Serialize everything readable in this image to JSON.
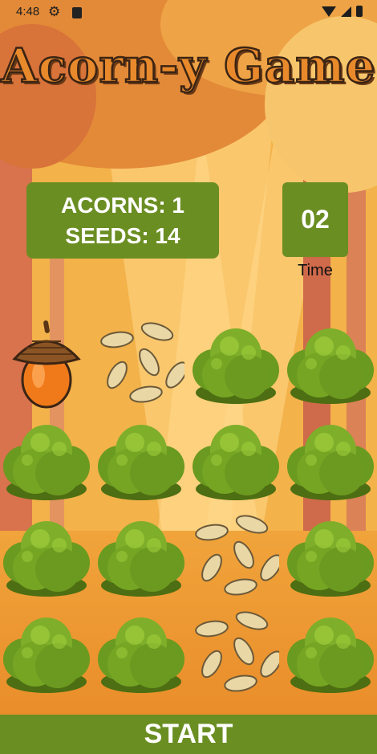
{
  "status_bar": {
    "time": "4:48",
    "icons": [
      "settings-icon",
      "sd-card-icon",
      "wifi-icon",
      "signal-icon",
      "battery-icon"
    ]
  },
  "title": "Acorn-y Game",
  "score": {
    "acorns_label": "ACORNS: 1",
    "seeds_label": "SEEDS: 14"
  },
  "timer": {
    "value": "02",
    "label": "Time"
  },
  "grid": [
    [
      "acorn",
      "seeds",
      "bush",
      "bush"
    ],
    [
      "bush",
      "bush",
      "bush",
      "bush"
    ],
    [
      "bush",
      "bush",
      "seeds",
      "bush"
    ],
    [
      "bush",
      "bush",
      "seeds",
      "bush"
    ]
  ],
  "start_label": "START",
  "colors": {
    "accent_green": "#6b8e23",
    "background_orange": "#f3b24a"
  }
}
